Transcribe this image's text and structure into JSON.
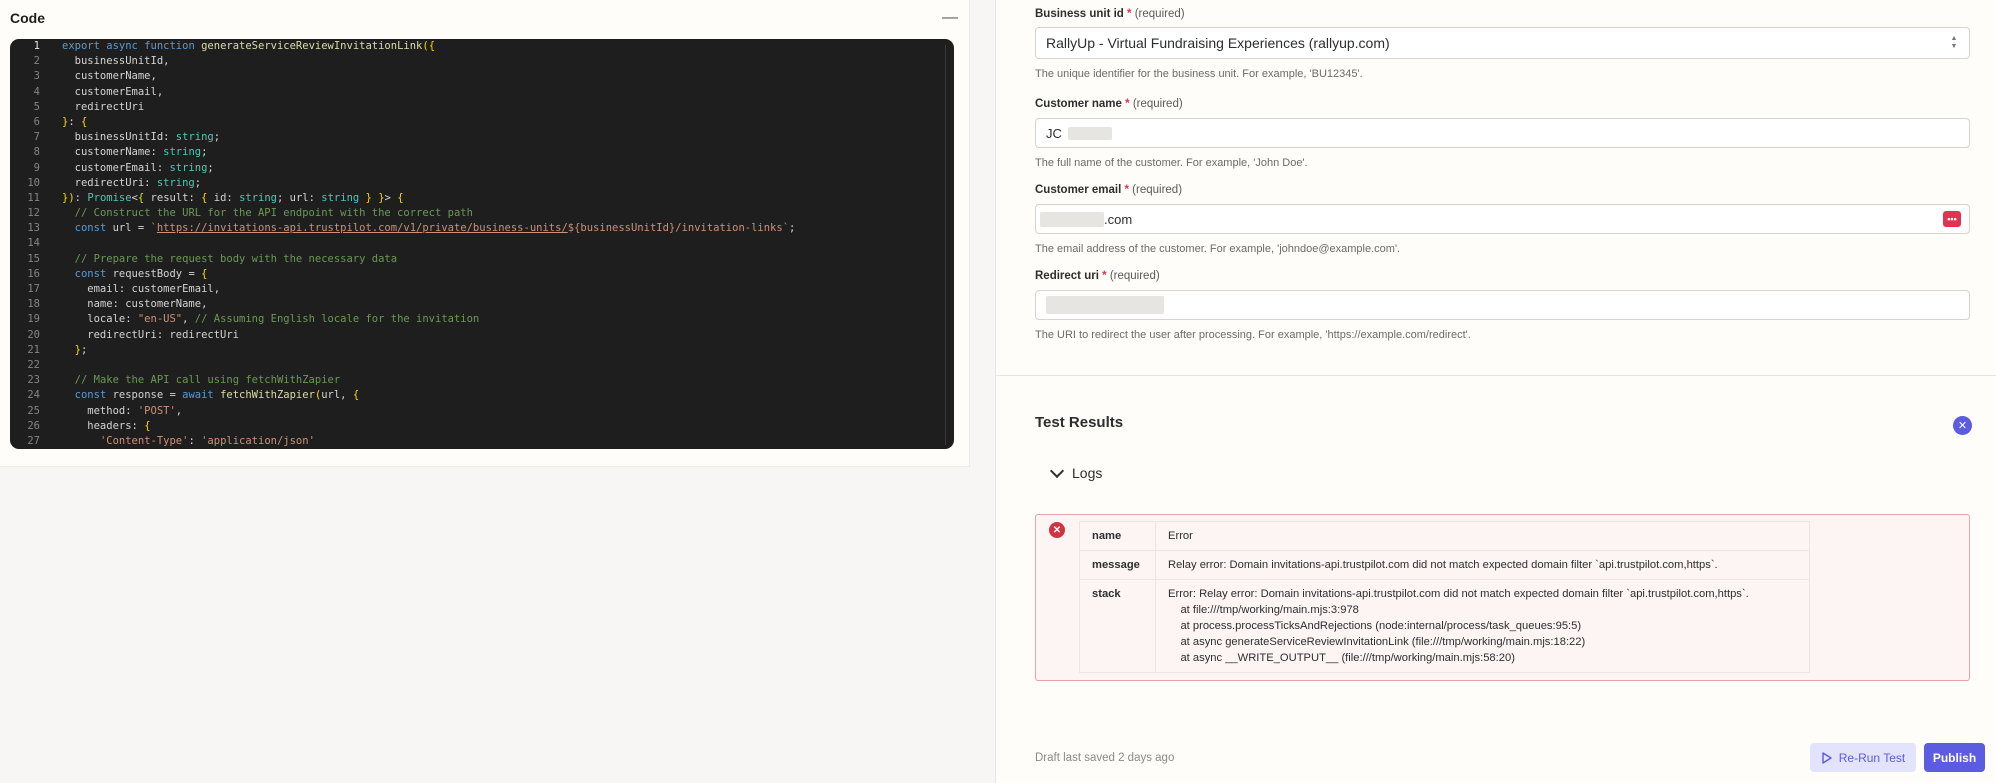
{
  "code_panel": {
    "title": "Code",
    "collapse_icon": "minus-icon",
    "lines": [
      "export async function generateServiceReviewInvitationLink({",
      "  businessUnitId,",
      "  customerName,",
      "  customerEmail,",
      "  redirectUri",
      "}: {",
      "  businessUnitId: string;",
      "  customerName: string;",
      "  customerEmail: string;",
      "  redirectUri: string;",
      "}): Promise<{ result: { id: string; url: string } }> {",
      "  // Construct the URL for the API endpoint with the correct path",
      "  const url = `https://invitations-api.trustpilot.com/v1/private/business-units/${businessUnitId}/invitation-links`;",
      "",
      "  // Prepare the request body with the necessary data",
      "  const requestBody = {",
      "    email: customerEmail,",
      "    name: customerName,",
      "    locale: \"en-US\", // Assuming English locale for the invitation",
      "    redirectUri: redirectUri",
      "  };",
      "",
      "  // Make the API call using fetchWithZapier",
      "  const response = await fetchWithZapier(url, {",
      "    method: 'POST',",
      "    headers: {",
      "      'Content-Type': 'application/json'"
    ]
  },
  "form": {
    "business_unit": {
      "label": "Business unit id",
      "required_mark": "*",
      "required_hint": "(required)",
      "value": "RallyUp - Virtual Fundraising Experiences (rallyup.com)",
      "help": "The unique identifier for the business unit. For example, 'BU12345'."
    },
    "customer_name": {
      "label": "Customer name",
      "required_mark": "*",
      "required_hint": "(required)",
      "value": "JC",
      "help": "The full name of the customer. For example, 'John Doe'."
    },
    "customer_email": {
      "label": "Customer email",
      "required_mark": "*",
      "required_hint": "(required)",
      "value": ".com",
      "help": "The email address of the customer. For example, 'johndoe@example.com'.",
      "extension_icon": "password-manager-icon",
      "extension_glyph": "•••"
    },
    "redirect_uri": {
      "label": "Redirect uri",
      "required_mark": "*",
      "required_hint": "(required)",
      "value": "",
      "help": "The URI to redirect the user after processing. For example, 'https://example.com/redirect'."
    }
  },
  "results": {
    "title": "Test Results",
    "close_glyph": "✕",
    "logs_label": "Logs",
    "error": {
      "icon_glyph": "✕",
      "rows": [
        {
          "key": "name",
          "value": "Error"
        },
        {
          "key": "message",
          "value": "Relay error: Domain invitations-api.trustpilot.com did not match expected domain filter `api.trustpilot.com,https`."
        },
        {
          "key": "stack",
          "value": "Error: Relay error: Domain invitations-api.trustpilot.com did not match expected domain filter `api.trustpilot.com,https`.\n    at file:///tmp/working/main.mjs:3:978\n    at process.processTicksAndRejections (node:internal/process/task_queues:95:5)\n    at async generateServiceReviewInvitationLink (file:///tmp/working/main.mjs:18:22)\n    at async __WRITE_OUTPUT__ (file:///tmp/working/main.mjs:58:20)"
        }
      ]
    }
  },
  "footer": {
    "draft_status": "Draft last saved 2 days ago",
    "rerun_label": "Re-Run Test",
    "publish_label": "Publish"
  },
  "colors": {
    "accent": "#5c5ce0",
    "required": "#e0334f",
    "error_bg": "#fdf4f4",
    "error_border": "#e9a4a8",
    "editor_bg": "#1e1e1e"
  }
}
